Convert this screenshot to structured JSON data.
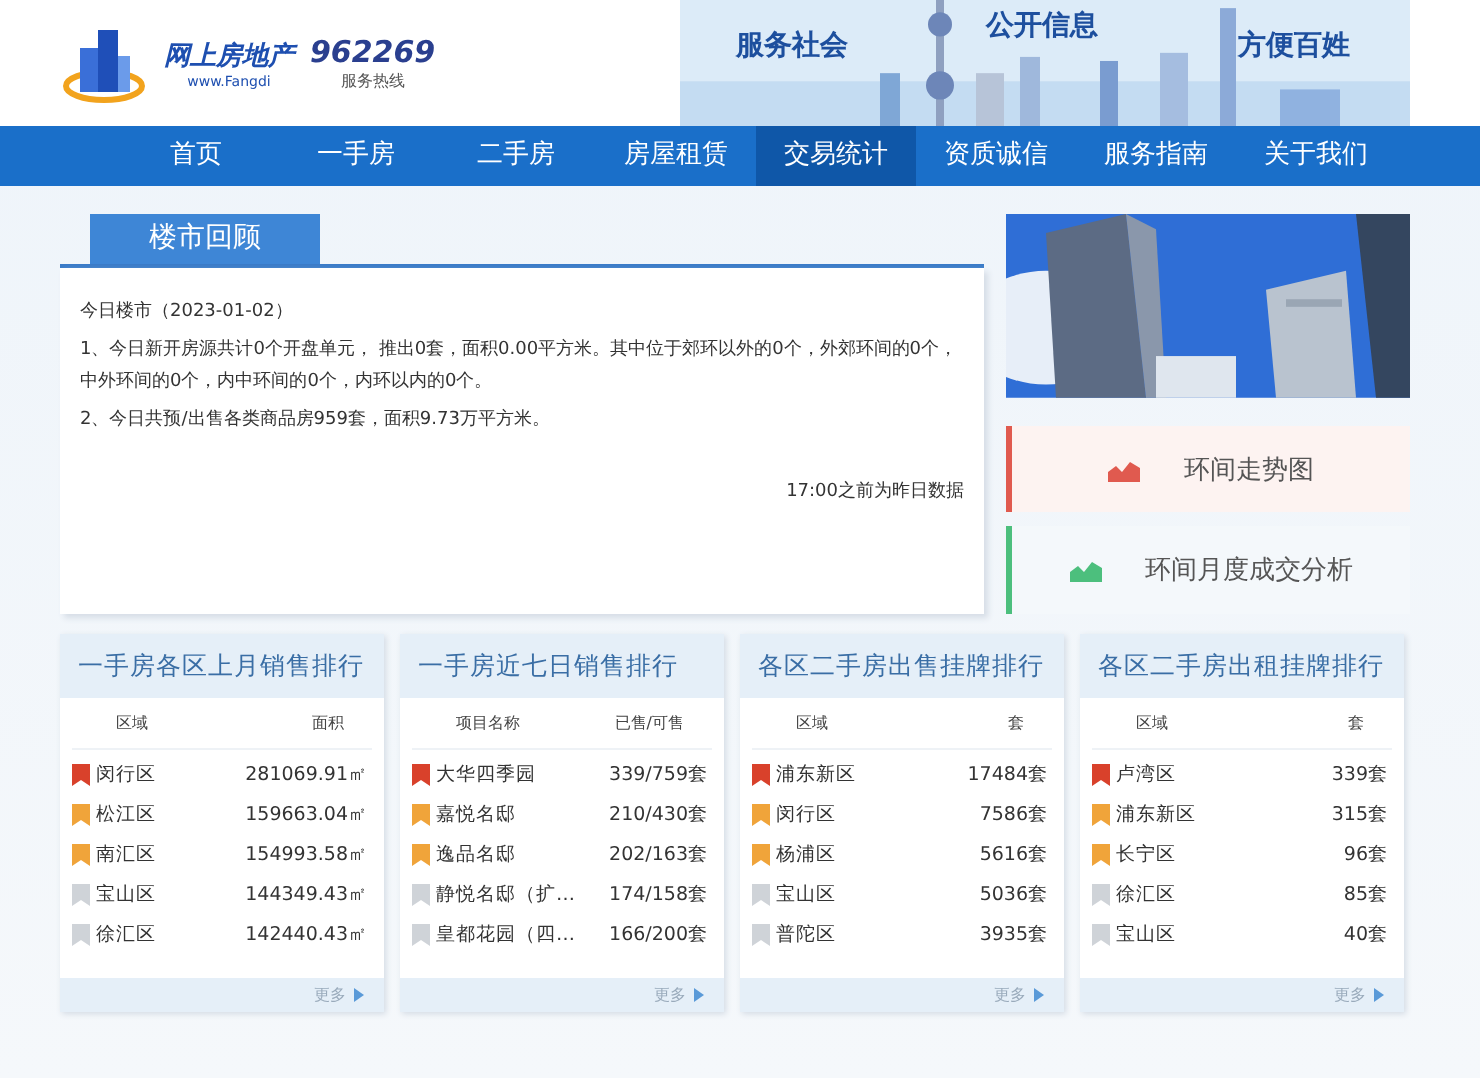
{
  "header": {
    "logo_text": "网上房地产",
    "logo_url": "www.Fangdi",
    "hotline": "962269",
    "hotline_label": "服务热线",
    "slogans": [
      "服务社会",
      "公开信息",
      "方便百姓"
    ]
  },
  "nav": [
    {
      "label": "首页",
      "selected": false
    },
    {
      "label": "一手房",
      "selected": false
    },
    {
      "label": "二手房",
      "selected": false
    },
    {
      "label": "房屋租赁",
      "selected": false
    },
    {
      "label": "交易统计",
      "selected": true
    },
    {
      "label": "资质诚信",
      "selected": false
    },
    {
      "label": "服务指南",
      "selected": false
    },
    {
      "label": "关于我们",
      "selected": false
    }
  ],
  "review": {
    "tab": "楼市回顾",
    "date_line": "今日楼市（2023-01-02）",
    "lines": [
      "1、今日新开房源共计0个开盘单元， 推出0套，面积0.00平方米。其中位于郊环以外的0个，外郊环间的0个，中外环间的0个，内中环间的0个，内环以内的0个。",
      "2、今日共预/出售各类商品房959套，面积9.73万平方米。"
    ],
    "note": "17:00之前为昨日数据"
  },
  "side_links": [
    {
      "label": "环间走势图",
      "color": "#e05a4f"
    },
    {
      "label": "环间月度成交分析",
      "color": "#4cbf7d"
    }
  ],
  "rankings": [
    {
      "title": "一手房各区上月销售排行",
      "columns": [
        "区域",
        "面积"
      ],
      "rows": [
        [
          "闵行区",
          "281069.91㎡"
        ],
        [
          "松江区",
          "159663.04㎡"
        ],
        [
          "南汇区",
          "154993.58㎡"
        ],
        [
          "宝山区",
          "144349.43㎡"
        ],
        [
          "徐汇区",
          "142440.43㎡"
        ]
      ],
      "more": "更多"
    },
    {
      "title": "一手房近七日销售排行",
      "columns": [
        "项目名称",
        "已售/可售"
      ],
      "rows": [
        [
          "大华四季园",
          "339/759套"
        ],
        [
          "嘉悦名邸",
          "210/430套"
        ],
        [
          "逸品名邸",
          "202/163套"
        ],
        [
          "静悦名邸（扩…",
          "174/158套"
        ],
        [
          "皇都花园（四…",
          "166/200套"
        ]
      ],
      "more": "更多"
    },
    {
      "title": "各区二手房出售挂牌排行",
      "columns": [
        "区域",
        "套"
      ],
      "rows": [
        [
          "浦东新区",
          "17484套"
        ],
        [
          "闵行区",
          "7586套"
        ],
        [
          "杨浦区",
          "5616套"
        ],
        [
          "宝山区",
          "5036套"
        ],
        [
          "普陀区",
          "3935套"
        ]
      ],
      "more": "更多"
    },
    {
      "title": "各区二手房出租挂牌排行",
      "columns": [
        "区域",
        "套"
      ],
      "rows": [
        [
          "卢湾区",
          "339套"
        ],
        [
          "浦东新区",
          "315套"
        ],
        [
          "长宁区",
          "96套"
        ],
        [
          "徐汇区",
          "85套"
        ],
        [
          "宝山区",
          "40套"
        ]
      ],
      "more": "更多"
    }
  ]
}
